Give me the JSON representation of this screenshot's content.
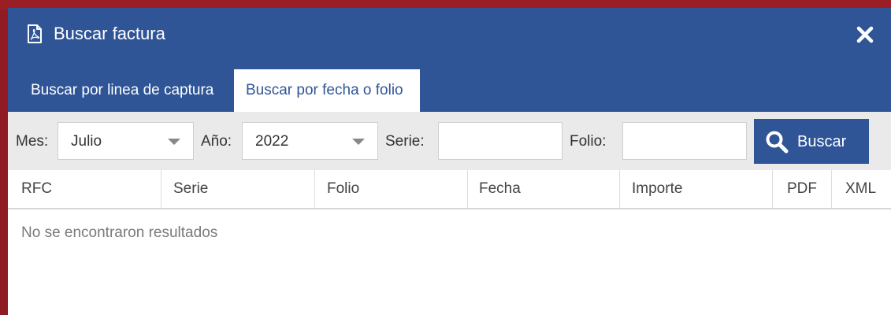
{
  "dialog": {
    "title": "Buscar factura",
    "title_icon": "pdf-file-icon",
    "close_icon": "close-icon"
  },
  "tabs": [
    {
      "label": "Buscar por linea de captura",
      "active": false
    },
    {
      "label": "Buscar por fecha o folio",
      "active": true
    }
  ],
  "filters": {
    "month_label": "Mes:",
    "month_value": "Julio",
    "year_label": "Año:",
    "year_value": "2022",
    "serie_label": "Serie:",
    "serie_value": "",
    "folio_label": "Folio:",
    "folio_value": "",
    "search_label": "Buscar",
    "search_icon": "search-icon"
  },
  "table": {
    "columns": [
      "RFC",
      "Serie",
      "Folio",
      "Fecha",
      "Importe",
      "PDF",
      "XML"
    ],
    "empty_message": "No se encontraron resultados"
  },
  "colors": {
    "primary": "#2f5597",
    "filter_bar": "#eaeaea",
    "muted_text": "#7a7a7a"
  }
}
